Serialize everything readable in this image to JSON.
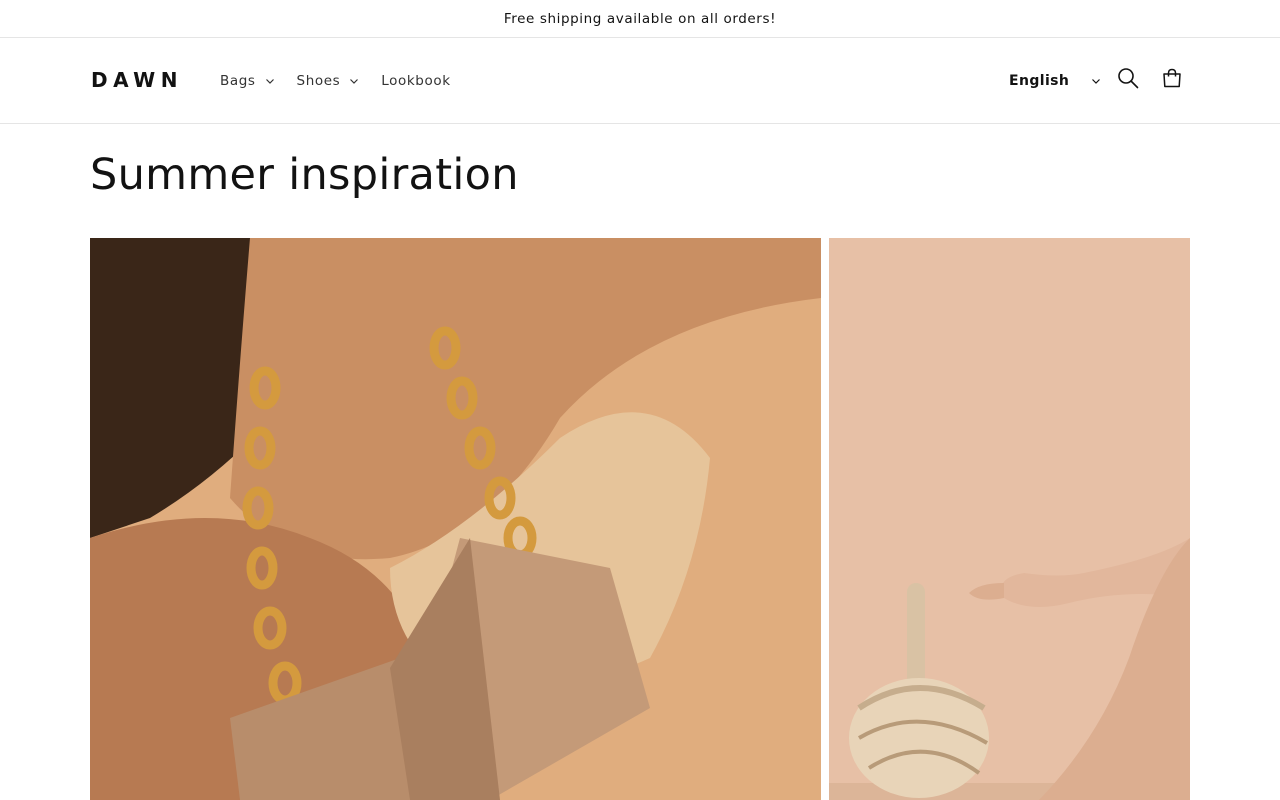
{
  "announcement": {
    "text": "Free shipping available on all orders!"
  },
  "header": {
    "logo": "DAWN",
    "nav": [
      {
        "label": "Bags",
        "has_dropdown": true
      },
      {
        "label": "Shoes",
        "has_dropdown": true
      },
      {
        "label": "Lookbook",
        "has_dropdown": false
      }
    ],
    "language": {
      "selected": "English"
    },
    "icons": {
      "search": "search-icon",
      "cart": "cart-icon",
      "dropdown": "chevron-down-icon"
    }
  },
  "main": {
    "title": "Summer inspiration",
    "images": [
      {
        "description": "model-with-chain-strap-bag",
        "background": "#e0ad7e"
      },
      {
        "description": "hand-holding-round-bucket-bag",
        "background": "#e7c0a6"
      }
    ]
  },
  "colors": {
    "text": "#121212",
    "border": "#e5e5e5",
    "background": "#ffffff"
  }
}
